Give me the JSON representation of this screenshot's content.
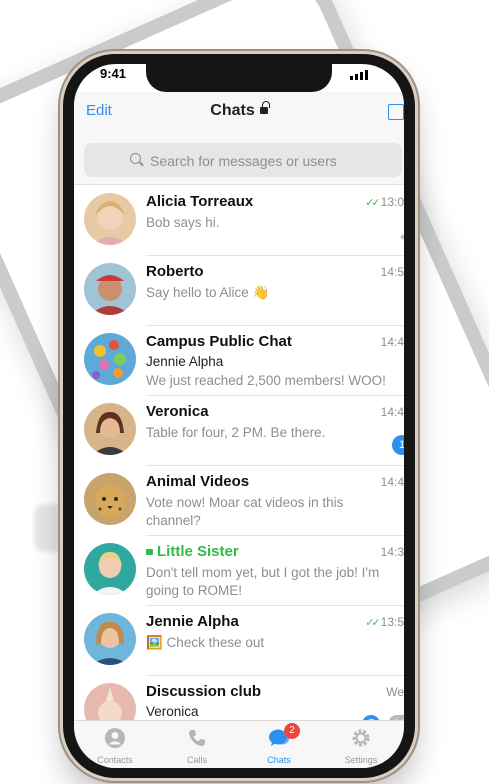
{
  "status": {
    "time": "9:41"
  },
  "nav": {
    "edit": "Edit",
    "title": "Chats"
  },
  "search": {
    "placeholder": "Search for messages or users"
  },
  "chats": [
    {
      "name": "Alicia Torreaux",
      "time": "13:0",
      "read": true,
      "message": "Bob says hi."
    },
    {
      "name": "Roberto",
      "time": "14:5",
      "message": "Say hello to Alice 👋"
    },
    {
      "name": "Campus Public Chat",
      "time": "14:4",
      "sender": "Jennie Alpha",
      "message": "We just reached 2,500 members! WOO!"
    },
    {
      "name": "Veronica",
      "time": "14:4",
      "message": "Table for four, 2 PM. Be there.",
      "unread": "1"
    },
    {
      "name": "Animal Videos",
      "time": "14:4",
      "message": "Vote now! Moar cat videos in this channel?"
    },
    {
      "name": "Little Sister",
      "time": "14:3",
      "message": "Don't tell mom yet, but I got the job! I'm going to ROME!"
    },
    {
      "name": "Jennie Alpha",
      "time": "13:5",
      "read": true,
      "message": "🖼️ Check these out"
    },
    {
      "name": "Discussion club",
      "time": "We",
      "sender": "Veronica",
      "unread": "96"
    }
  ],
  "tabs": [
    {
      "label": "Contacts"
    },
    {
      "label": "Calls"
    },
    {
      "label": "Chats",
      "badge": "2"
    },
    {
      "label": "Settings"
    }
  ],
  "colors": {
    "accent": "#2d8ff0",
    "secret": "#36b84a",
    "badge_red": "#f0453a"
  }
}
